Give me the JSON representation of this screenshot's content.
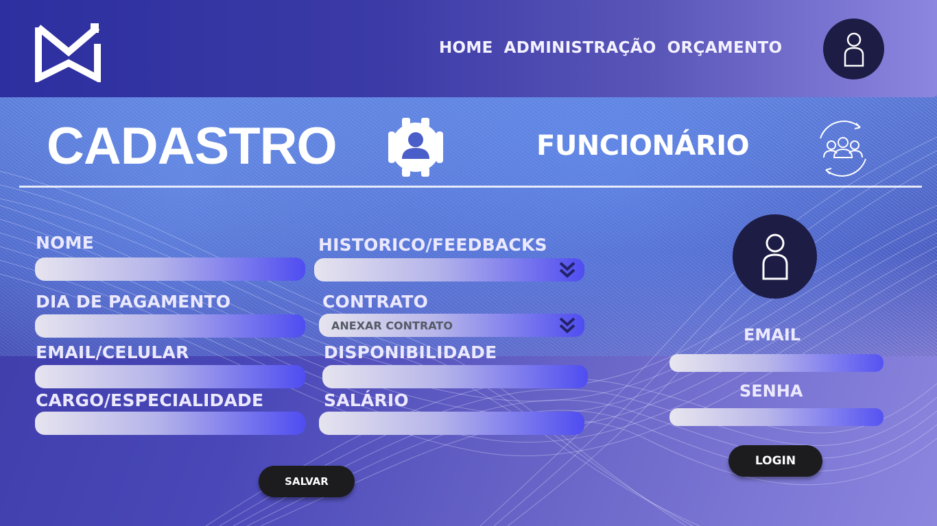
{
  "header": {
    "nav": [
      "HOME",
      "ADMINISTRAÇÃO",
      "ORÇAMENTO"
    ]
  },
  "title": {
    "cadastro": "CADASTRO",
    "funcionario": "FUNCIONÁRIO"
  },
  "form": {
    "nome_label": "NOME",
    "historico_label": "HISTORICO/FEEDBACKS",
    "dia_pagamento_label": "DIA DE PAGAMENTO",
    "contrato_label": "CONTRATO",
    "contrato_placeholder": "ANEXAR CONTRATO",
    "email_celular_label": "EMAIL/CELULAR",
    "disponibilidade_label": "DISPONIBILIDADE",
    "cargo_label": "CARGO/ESPECIALIDADE",
    "salario_label": "SALÁRIO",
    "save_label": "SALVAR"
  },
  "login": {
    "email_label": "EMAIL",
    "senha_label": "SENHA",
    "login_label": "LOGIN"
  },
  "colors": {
    "header_start": "#2d2fa0",
    "header_end": "#8d86e0",
    "avatar_bg": "#1d1c45",
    "button_bg": "#1c1c1f",
    "field_end": "#4f4df0"
  },
  "icons": [
    "brand-logo-icon",
    "user-icon",
    "user-gear-icon",
    "team-refresh-icon",
    "double-chevron-down-icon"
  ]
}
